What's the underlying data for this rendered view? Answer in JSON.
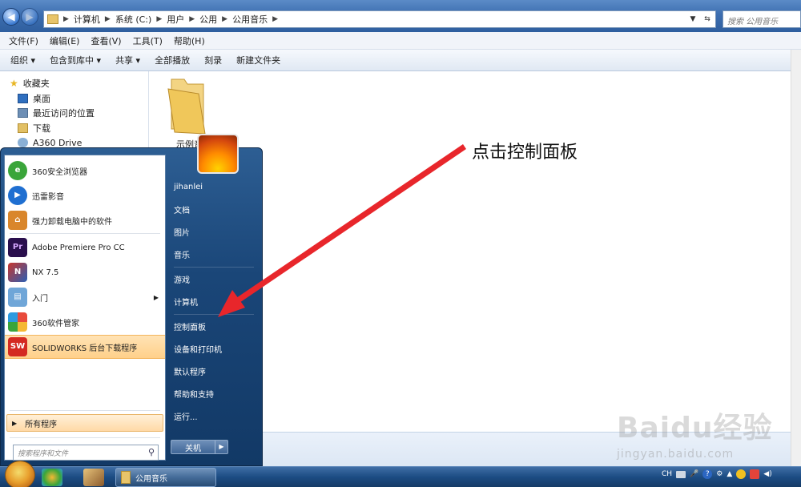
{
  "explorer": {
    "address": {
      "crumbs": [
        "计算机",
        "系统 (C:)",
        "用户",
        "公用",
        "公用音乐"
      ],
      "search_placeholder": "搜索 公用音乐"
    },
    "menu": [
      "文件(F)",
      "编辑(E)",
      "查看(V)",
      "工具(T)",
      "帮助(H)"
    ],
    "toolbar": [
      "组织 ▾",
      "包含到库中 ▾",
      "共享 ▾",
      "全部播放",
      "刻录",
      "新建文件夹"
    ],
    "nav": [
      {
        "label": "收藏夹",
        "icon": "star-icon"
      },
      {
        "label": "桌面",
        "icon": "desktop-icon"
      },
      {
        "label": "最近访问的位置",
        "icon": "recent-places-icon"
      },
      {
        "label": "下载",
        "icon": "download-folder-icon"
      },
      {
        "label": "A360 Drive",
        "icon": "cloud-drive-icon"
      }
    ],
    "folder_item": "示例音"
  },
  "start_menu": {
    "programs": [
      {
        "label": "360安全浏览器",
        "icon": "360-browser-icon",
        "color": "#3aa53a"
      },
      {
        "label": "迅雷影音",
        "icon": "xunlei-player-icon",
        "color": "#1f6fd1"
      },
      {
        "label": "强力卸载电脑中的软件",
        "icon": "uninstaller-icon",
        "color": "#d9862b"
      },
      {
        "label": "Adobe Premiere Pro CC",
        "icon": "premiere-pro-icon",
        "color": "#2a0f4d"
      },
      {
        "label": "NX 7.5",
        "icon": "nx-icon",
        "color": "#c8352c"
      },
      {
        "label": "入门",
        "icon": "getting-started-icon",
        "color": "#6fa6d8"
      },
      {
        "label": "360软件管家",
        "icon": "360-software-manager-icon",
        "color": "#2d9ae0"
      },
      {
        "label": "SOLIDWORKS 后台下载程序",
        "icon": "solidworks-icon",
        "color": "#d42a22"
      }
    ],
    "all_programs": "所有程序",
    "search_placeholder": "搜索程序和文件",
    "right": [
      "jihanlei",
      "文档",
      "图片",
      "音乐",
      "游戏",
      "计算机",
      "控制面板",
      "设备和打印机",
      "默认程序",
      "帮助和支持",
      "运行..."
    ],
    "shutdown": "关机"
  },
  "annotation": "点击控制面板",
  "taskbar": {
    "task_label": "公用音乐",
    "tray_lang": "CH"
  },
  "watermark": {
    "brand": "Baidu经验",
    "url": "jingyan.baidu.com"
  }
}
